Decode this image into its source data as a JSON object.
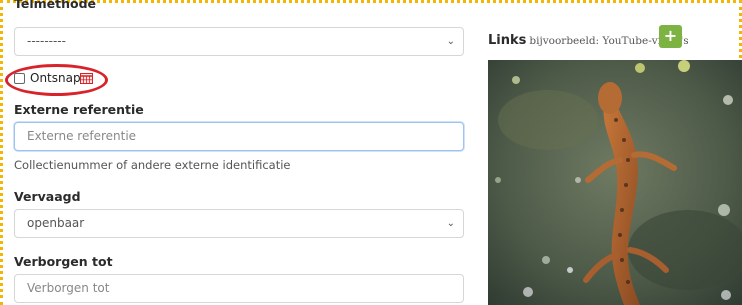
{
  "form": {
    "count_method": {
      "label": "Telmethode",
      "value": "---------"
    },
    "escaped": {
      "label": "Ontsnapt",
      "checked": false
    },
    "external_reference": {
      "label": "Externe referentie",
      "placeholder": "Externe referentie",
      "help": "Collectienummer of andere externe identificatie"
    },
    "obscured": {
      "label": "Vervaagd",
      "value": "openbaar"
    },
    "hidden_until": {
      "label": "Verborgen tot",
      "placeholder": "Verborgen tot"
    }
  },
  "links": {
    "title": "Links",
    "hint": "bijvoorbeeld: YouTube-video's",
    "add_label": "+"
  },
  "photo": {
    "subject": "newt in water"
  },
  "icons": {
    "calendar": "calendar-icon",
    "chevron": "chevron-down-icon",
    "add": "plus-icon"
  },
  "colors": {
    "accent_green": "#7cb342",
    "highlight_red": "#d8232a",
    "dotted_border": "#f2b705"
  }
}
